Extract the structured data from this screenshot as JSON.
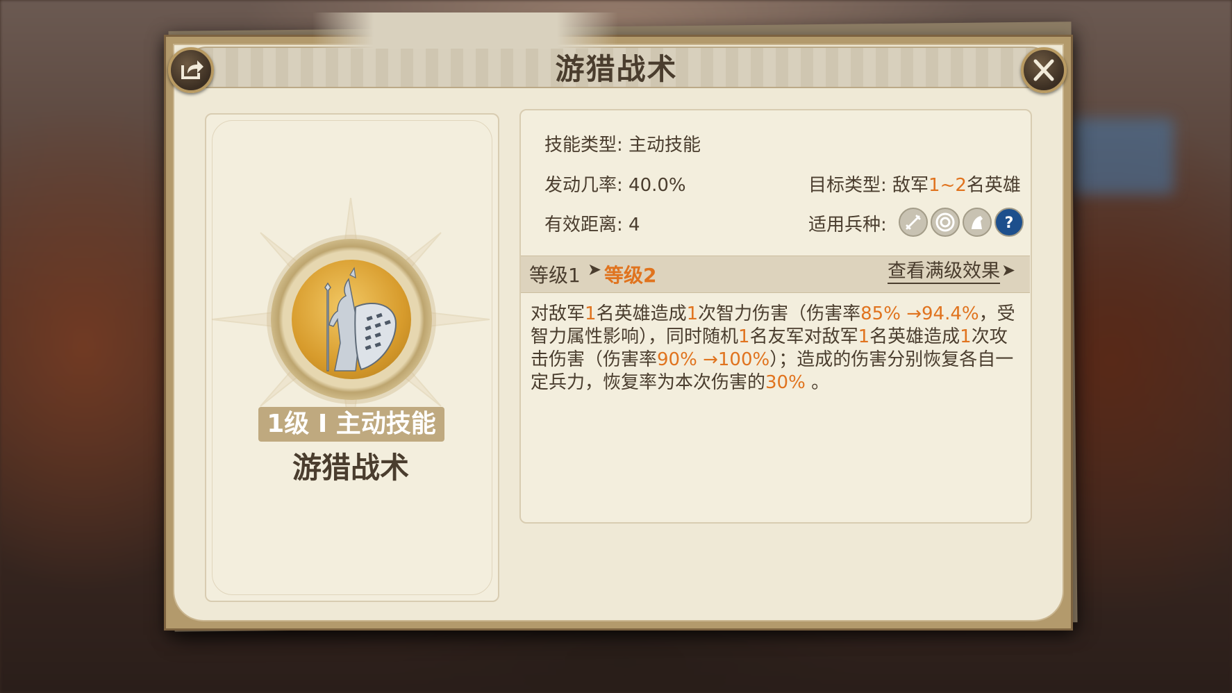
{
  "dialog": {
    "title": "游猎战术"
  },
  "skill": {
    "badge": "1级 I 主动技能",
    "name": "游猎战术"
  },
  "info": {
    "type_label": "技能类型:",
    "type_value": "主动技能",
    "rate_label": "发动几率:",
    "rate_value": "40.0%",
    "target_label": "目标类型:",
    "target_prefix": "敌军",
    "target_range": "1~2",
    "target_suffix": "名英雄",
    "range_label": "有效距离:",
    "range_value": "4",
    "troops_label": "适用兵种:"
  },
  "troop_icons": [
    "infantry-icon",
    "archer-icon",
    "cavalry-icon",
    "unknown-icon"
  ],
  "levels": {
    "current": "等级1",
    "next": "等级2",
    "arrow": "➤",
    "view_max": "查看满级效果"
  },
  "description": {
    "p1": "对敌军",
    "n1": "1",
    "p2": "名英雄造成",
    "n2": "1",
    "p3": "次智力伤害（伤害率",
    "n3": "85% →94.4%",
    "p4": "，受智力属性影响），同时随机",
    "n4": "1",
    "p5": "名友军对敌军",
    "n5": "1",
    "p6": "名英雄造成",
    "n6": "1",
    "p7": "次攻击伤害（伤害率",
    "n7": "90% →100%",
    "p8": "）；造成的伤害分别恢复各自一定兵力，恢复率为本次伤害的",
    "n8": "30%",
    "p9": " 。"
  },
  "colors": {
    "highlight": "#e0731e",
    "text": "#4a3d2e",
    "parchment": "#efe9d6"
  }
}
